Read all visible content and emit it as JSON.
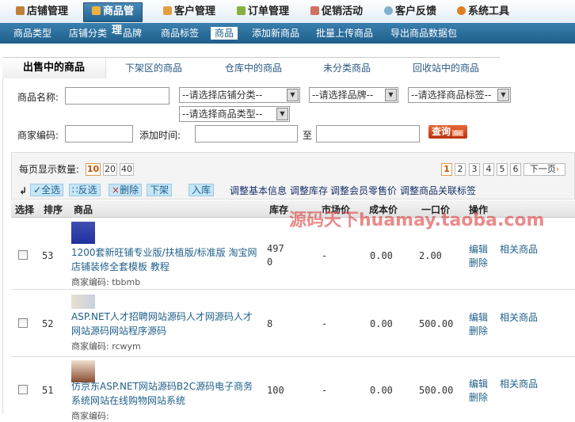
{
  "topnav": [
    {
      "label": "店铺管理",
      "color": "#c0803a"
    },
    {
      "label": "商品管",
      "color": "#f0b040"
    },
    {
      "label": "客户管理",
      "color": "#e0a040"
    },
    {
      "label": "订单管理",
      "color": "#88b040"
    },
    {
      "label": "促销活动",
      "color": "#d07060"
    },
    {
      "label": "客户反馈",
      "color": "#80b0d0"
    },
    {
      "label": "系统工具",
      "color": "#e08020"
    }
  ],
  "subnav": [
    "商品类型",
    "店铺分类",
    "理",
    "品牌",
    "商品标签",
    "商品",
    "添加新商品",
    "批量上传商品",
    "导出商品数据包"
  ],
  "tabs": [
    "出售中的商品",
    "下架区的商品",
    "仓库中的商品",
    "未分类商品",
    "回收站中的商品"
  ],
  "search": {
    "name_label": "商品名称:",
    "shop_cat": "--请选择店铺分类--",
    "brand": "--请选择品牌--",
    "tag": "--请选择商品标签--",
    "type": "--请选择商品类型--",
    "code_label": "商家编码:",
    "time_label": "添加时间:",
    "to": "至",
    "query": "查询",
    "go": "Go"
  },
  "perpage": {
    "label": "每页显示数量:",
    "options": [
      "10",
      "20",
      "40"
    ]
  },
  "pagination": [
    "1",
    "2",
    "3",
    "4",
    "5",
    "6",
    "下一页"
  ],
  "actions": {
    "select_all": "全选",
    "invert": "反选",
    "delete": "删除",
    "unshelf": "下架",
    "store": "入库",
    "links": [
      "调整基本信息",
      "调整库存",
      "调整会员零售价",
      "调整商品关联标签"
    ]
  },
  "columns": [
    "选择",
    "排序",
    "商品",
    "库存",
    "市场价",
    "成本价",
    "一口价",
    "操作"
  ],
  "watermark": "源码天下huamay.taoba.com",
  "rows": [
    {
      "sort": "53",
      "name": "1200套新旺铺专业版/扶植版/标准版 淘宝网店铺装修全套模板 教程",
      "code": "商家编码: tbbmb",
      "stock1": "497",
      "stock2": "0",
      "market": "-",
      "cost": "0.00",
      "price": "2.00",
      "edit": "编辑",
      "del": "删除",
      "related": "相关商品"
    },
    {
      "sort": "52",
      "name": "ASP.NET人才招聘网站源码人才网源码人才网站源码网站程序源码",
      "code": "商家编码: rcwym",
      "stock1": "8",
      "stock2": "",
      "market": "-",
      "cost": "0.00",
      "price": "500.00",
      "edit": "编辑",
      "del": "删除",
      "related": "相关商品"
    },
    {
      "sort": "51",
      "name": "仿京东ASP.NET网站源码B2C源码电子商务系统网站在线购物网站系统",
      "code": "商家编码:",
      "stock1": "100",
      "stock2": "",
      "market": "-",
      "cost": "0.00",
      "price": "500.00",
      "edit": "编辑",
      "del": "删除",
      "related": "相关商品"
    }
  ]
}
